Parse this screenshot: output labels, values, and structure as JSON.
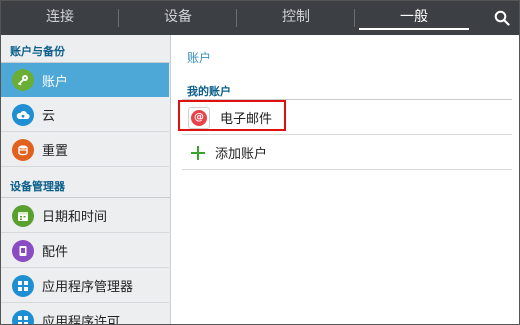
{
  "tabs": [
    {
      "label": "连接"
    },
    {
      "label": "设备"
    },
    {
      "label": "控制"
    },
    {
      "label": "一般"
    }
  ],
  "sidebar": {
    "sections": [
      {
        "title": "账户与备份",
        "items": [
          {
            "label": "账户",
            "icon": "key-icon",
            "color": "#6aae36"
          },
          {
            "label": "云",
            "icon": "cloud-icon",
            "color": "#1f8fd3"
          },
          {
            "label": "重置",
            "icon": "reset-icon",
            "color": "#e0621e"
          }
        ]
      },
      {
        "title": "设备管理器",
        "items": [
          {
            "label": "日期和时间",
            "icon": "calendar-icon",
            "color": "#5aa030"
          },
          {
            "label": "配件",
            "icon": "accessory-icon",
            "color": "#8a4cc2"
          },
          {
            "label": "应用程序管理器",
            "icon": "apps-grid-icon",
            "color": "#1f8fd3"
          },
          {
            "label": "应用程序许可",
            "icon": "apps-grid-icon",
            "color": "#1f8fd3"
          }
        ]
      }
    ]
  },
  "main": {
    "breadcrumb": "账户",
    "section_title": "我的账户",
    "accounts": [
      {
        "label": "电子邮件",
        "icon": "email-icon"
      }
    ],
    "add_account_label": "添加账户"
  },
  "colors": {
    "tabbar": "#3c3f44",
    "selected": "#4ea8d7",
    "section_header": "#0b5f8a",
    "highlight": "#e01010"
  }
}
